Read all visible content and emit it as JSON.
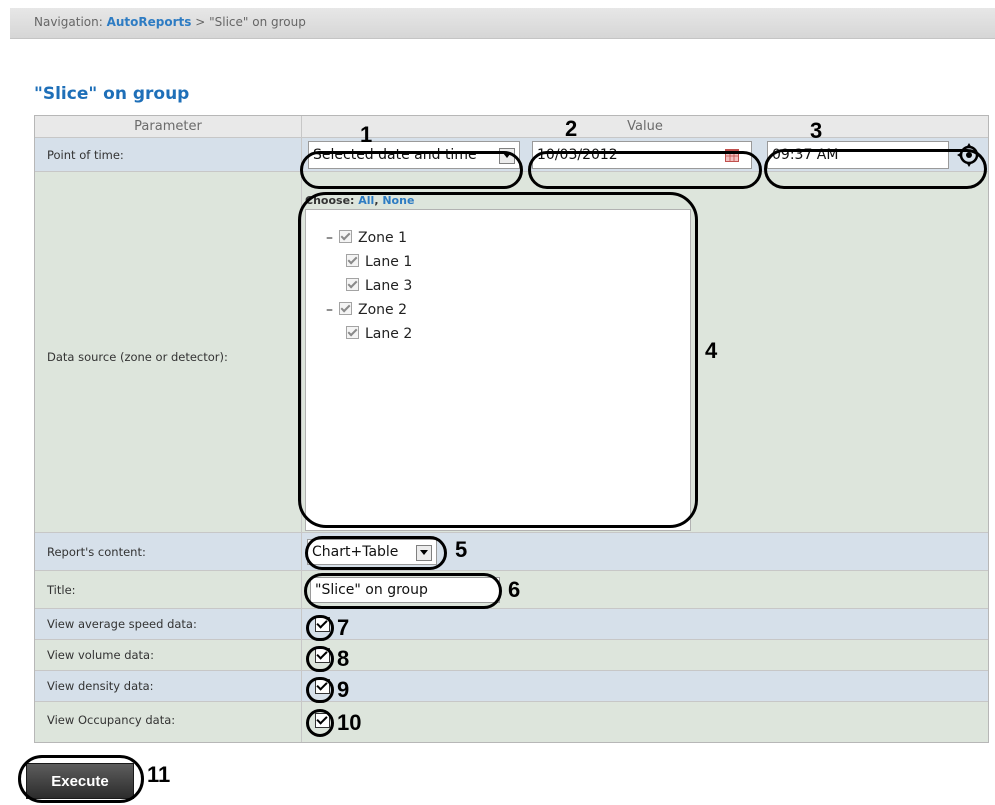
{
  "navigation": {
    "prefix": "Navigation: ",
    "link": "AutoReports",
    "separator": " > ",
    "current": "\"Slice\" on group"
  },
  "page_title": "\"Slice\" on group",
  "table": {
    "header": {
      "parameter": "Parameter",
      "value": "Value"
    },
    "rows": {
      "point_of_time": {
        "label": "Point of time:",
        "mode": "Selected date and time",
        "date": "10/03/2012",
        "time": "09:37 AM"
      },
      "data_source": {
        "label": "Data source (zone or detector):",
        "choose_prefix": "Choose: ",
        "choose_all": "All",
        "choose_sep": ", ",
        "choose_none": "None",
        "tree": [
          {
            "label": "Zone 1",
            "toggle": "–",
            "checked": true,
            "children": [
              {
                "label": "Lane 1",
                "checked": true
              },
              {
                "label": "Lane 3",
                "checked": true
              }
            ]
          },
          {
            "label": "Zone 2",
            "toggle": "–",
            "checked": true,
            "children": [
              {
                "label": "Lane 2",
                "checked": true
              }
            ]
          }
        ]
      },
      "report_content": {
        "label": "Report's content:",
        "value": "Chart+Table"
      },
      "title": {
        "label": "Title:",
        "value": "\"Slice\" on group"
      },
      "avg_speed": {
        "label": "View average speed data:",
        "checked": true
      },
      "volume": {
        "label": "View volume data:",
        "checked": true
      },
      "density": {
        "label": "View density data:",
        "checked": true
      },
      "occupancy": {
        "label": "View Occupancy data:",
        "checked": true
      }
    }
  },
  "execute_label": "Execute",
  "callouts": [
    "1",
    "2",
    "3",
    "4",
    "5",
    "6",
    "7",
    "8",
    "9",
    "10",
    "11"
  ],
  "colors": {
    "accent": "#2e7cc3",
    "row_blue": "#d6e0ea",
    "row_green": "#dde5dc"
  }
}
